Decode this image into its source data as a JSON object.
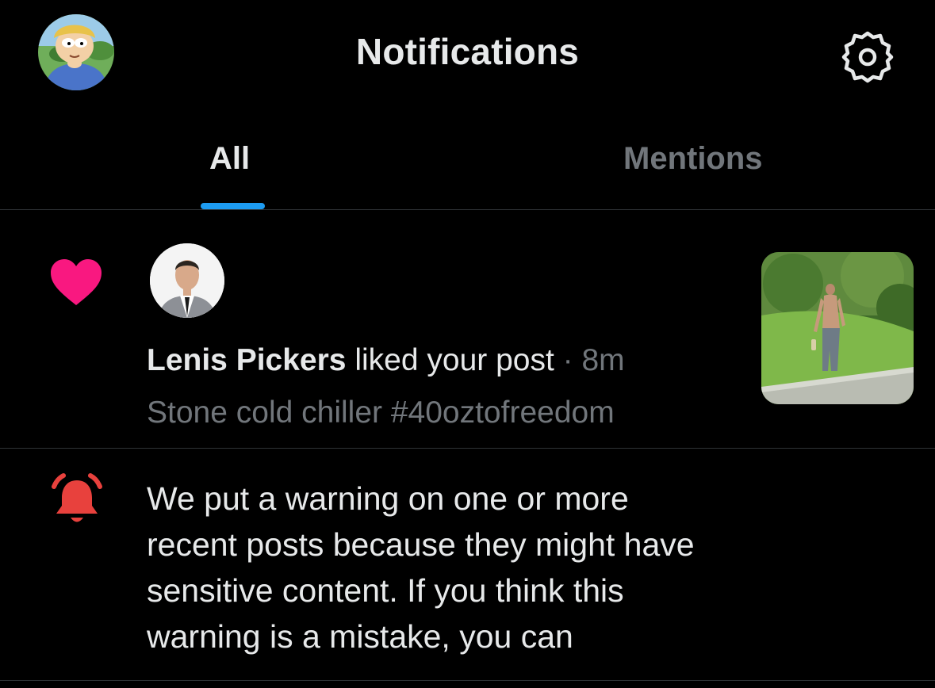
{
  "header": {
    "title": "Notifications",
    "avatar_icon": "cartoon-avatar-icon",
    "settings_icon": "gear-icon"
  },
  "tabs": [
    {
      "label": "All",
      "active": true
    },
    {
      "label": "Mentions",
      "active": false
    }
  ],
  "colors": {
    "background": "#000000",
    "text_primary": "#e7e9ea",
    "text_secondary": "#71767b",
    "accent": "#1d9bf0",
    "like": "#f91880",
    "alert": "#e8413d",
    "divider": "#2f3336"
  },
  "notifications": [
    {
      "type": "like",
      "icon": "heart-icon",
      "user_name": "Lenis Pickers",
      "action": "liked your post",
      "separator": "·",
      "time": "8m",
      "post_text": "Stone cold chiller #40oztofreedom",
      "thumbnail_icon": "post-photo-thumbnail"
    },
    {
      "type": "warning",
      "icon": "bell-icon",
      "text": "We put a warning on one or more recent posts because they might have sensitive content. If you think this warning is a mistake, you can"
    }
  ]
}
